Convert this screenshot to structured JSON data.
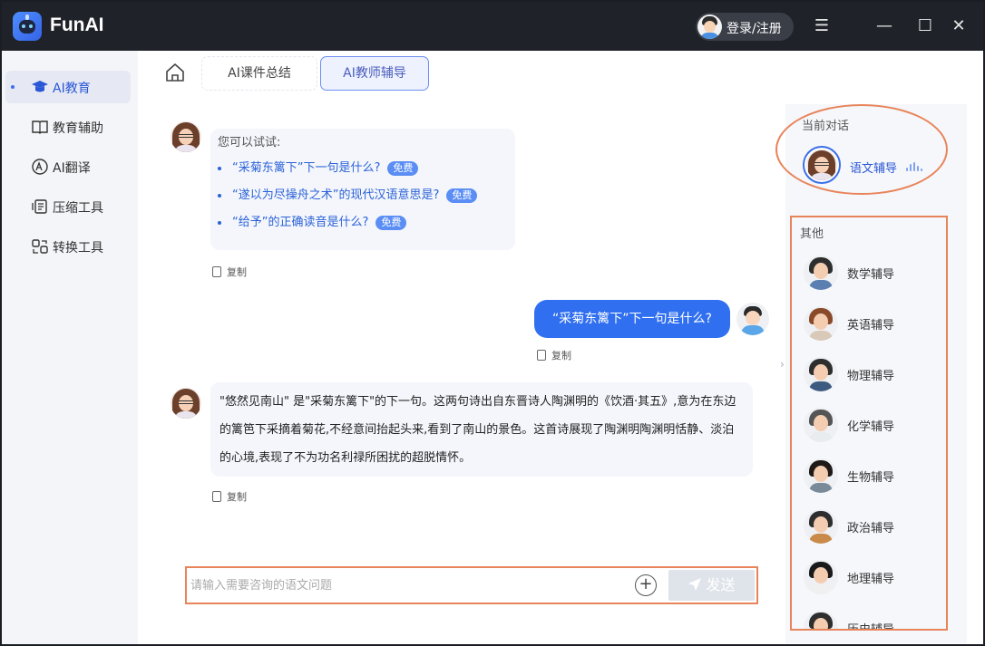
{
  "app": {
    "title": "FunAI",
    "login_label": "登录/注册"
  },
  "window_controls": {
    "menu": "☰",
    "minimize": "—",
    "maximize": "☐",
    "close": "✕"
  },
  "sidebar": {
    "items": [
      {
        "label": "AI教育",
        "icon": "graduation-cap-icon",
        "active": true
      },
      {
        "label": "教育辅助",
        "icon": "book-icon",
        "active": false
      },
      {
        "label": "AI翻译",
        "icon": "translate-icon",
        "active": false
      },
      {
        "label": "压缩工具",
        "icon": "compress-icon",
        "active": false
      },
      {
        "label": "转换工具",
        "icon": "convert-icon",
        "active": false
      }
    ]
  },
  "tabs": [
    {
      "label": "AI课件总结",
      "active": false
    },
    {
      "label": "AI教师辅导",
      "active": true
    }
  ],
  "chat": {
    "hint_title": "您可以试试:",
    "suggestions": [
      {
        "text": "“采菊东篱下”下一句是什么?",
        "badge": "免费"
      },
      {
        "text": "“遂以为尽操舟之术”的现代汉语意思是?",
        "badge": "免费"
      },
      {
        "text": "“给予”的正确读音是什么?",
        "badge": "免费"
      }
    ],
    "copy_label": "复制",
    "user_message": "“采菊东篱下”下一句是什么?",
    "answer": "\"悠然见南山\" 是\"采菊东篱下\"的下一句。这两句诗出自东晋诗人陶渊明的《饮酒·其五》,意为在东边的篱笆下采摘着菊花,不经意间抬起头来,看到了南山的景色。这首诗展现了陶渊明陶渊明恬静、淡泊的心境,表现了不为功名利禄所困扰的超脱情怀。"
  },
  "input": {
    "placeholder": "请输入需要咨询的语文问题",
    "value": "",
    "send_label": "发送"
  },
  "right_panel": {
    "current_title": "当前对话",
    "current_tutor": "语文辅导",
    "other_title": "其他",
    "tutors": [
      "数学辅导",
      "英语辅导",
      "物理辅导",
      "化学辅导",
      "生物辅导",
      "政治辅导",
      "地理辅导",
      "历史辅导"
    ]
  },
  "colors": {
    "accent": "#2f6ff0",
    "highlight_border": "#e8845a",
    "titlebar": "#1f2228"
  }
}
